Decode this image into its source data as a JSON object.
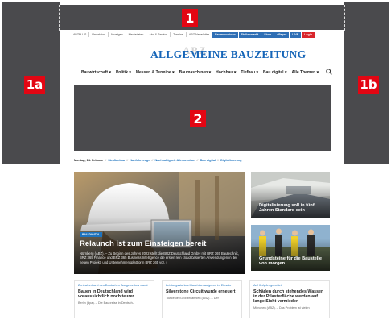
{
  "ad_labels": {
    "top": "1",
    "left": "1a",
    "right": "1b",
    "billboard": "2"
  },
  "topbar": {
    "links": [
      "ABZPLUS",
      "Redaktion",
      "Anzeigen",
      "Mediadaten",
      "Abo & Service",
      "Termine",
      "ABZ-Newsletter"
    ],
    "buttons": [
      "Baumaschinen",
      "Stellenmarkt",
      "Shop",
      "ePaper",
      "LIVE",
      "Login"
    ]
  },
  "logo": {
    "text": "ALLGEMEINE BAUZEITUNG",
    "shadow": "ABZ"
  },
  "nav": {
    "items": [
      "Bauwirtschaft",
      "Politik",
      "Messen & Termine",
      "Baumaschinen",
      "Hochbau",
      "Tiefbau",
      "Bau digital",
      "Alle Themen"
    ],
    "search_icon": "search-icon"
  },
  "breadcrumb": {
    "date": "Montag, 14. Februar",
    "items": [
      "Straßenbau",
      "Nahfahrzeuge",
      "Nachhaltigkeit & Innovation",
      "Bau digital",
      "Digitalisierung"
    ]
  },
  "hero": {
    "badge": "BAU DIGITAL",
    "title": "Relaunch ist zum Einsteigen bereit",
    "text": "Nürnberg (ABZ). – Zu Beginn des Jahres 2022 stellt die BRZ Deutschland GmbH mit BRZ 365 Bautechnik, BRZ 365 Finance und BRZ 365 Business Intelligence die ersten rein cloud-basierten Anwendungen in der neuen Projekt- und Unternehmensplattform BRZ 365 vor. ›"
  },
  "side_cards": [
    {
      "title": "Digitalisierung soll in fünf Jahren Standard sein"
    },
    {
      "title": "Grundsteine für die Baustelle von morgen"
    }
  ],
  "bottom_cards": [
    {
      "kicker": "Zentralverband des Deutschen Baugewerbes warnt",
      "title": "Bauen in Deutschland wird voraussichtlich noch teurer",
      "snippet": "Berlin (dpa). – Die Baupreise in Deutsch-"
    },
    {
      "kicker": "Leistungsstarkes Maschinenaufgebot im Einsatz",
      "title": "Silverstone Circuit wurde erneuert",
      "snippet": "Towcester/Großbritannien (ABZ). – Der"
    },
    {
      "kicker": "Auf Knüpfer gebettet",
      "title": "Schäden durch stehendes Wasser in der Pflasterfläche werden auf lange Sicht vermieden",
      "snippet": "München (ABZ). – Das Problem ist vielen"
    }
  ],
  "colors": {
    "ad_gray": "#4a4a4d",
    "label_red": "#e30613",
    "brand_blue": "#1565b8",
    "link_blue": "#1e73be"
  }
}
